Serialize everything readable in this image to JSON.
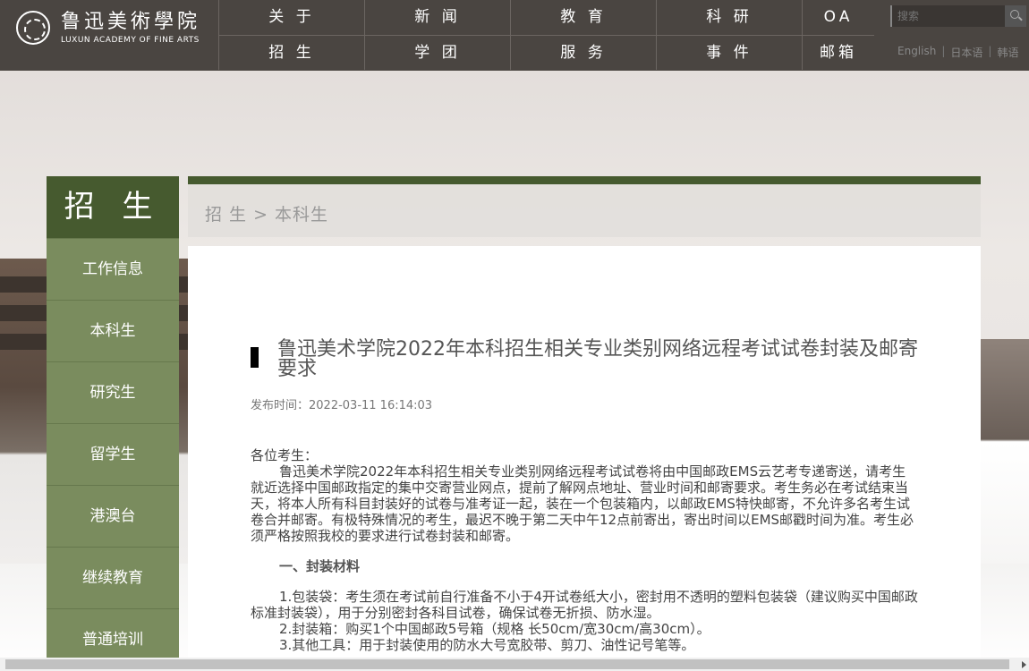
{
  "header": {
    "logo_cn": "鲁迅美術學院",
    "logo_en": "LUXUN ACADEMY OF FINE ARTS",
    "nav_top": [
      "关 于",
      "新 闻",
      "教 育",
      "科 研",
      "OA"
    ],
    "nav_bottom": [
      "招 生",
      "学 团",
      "服 务",
      "事 件",
      "邮箱"
    ],
    "search_placeholder": "搜索",
    "langs": [
      "English",
      "日本语",
      "韩语"
    ]
  },
  "sidebar": {
    "title": "招 生",
    "items": [
      "工作信息",
      "本科生",
      "研究生",
      "留学生",
      "港澳台",
      "继续教育",
      "普通培训"
    ]
  },
  "breadcrumb": "招 生 > 本科生",
  "article": {
    "title": "鲁迅美术学院2022年本科招生相关专业类别网络远程考试试卷封装及邮寄要求",
    "published": "发布时间：2022-03-11 16:14:03",
    "greeting": "各位考生：",
    "para1": "鲁迅美术学院2022年本科招生相关专业类别网络远程考试试卷将由中国邮政EMS云艺考专递寄送，请考生就近选择中国邮政指定的集中交寄营业网点，提前了解网点地址、营业时间和邮寄要求。考生务必在考试结束当天，将本人所有科目封装好的试卷与准考证一起，装在一个包装箱内，以邮政EMS特快邮寄，不允许多名考生试卷合并邮寄。有极特殊情况的考生，最迟不晚于第二天中午12点前寄出，寄出时间以EMS邮戳时间为准。考生必须严格按照我校的要求进行试卷封装和邮寄。",
    "section1": "一、封装材料",
    "item1": "1.包装袋：考生须在考试前自行准备不小于4开试卷纸大小，密封用不透明的塑料包装袋（建议购买中国邮政标准封装袋），用于分别密封各科目试卷，确保试卷无折损、防水湿。",
    "item2": "2.封装箱：购买1个中国邮政5号箱（规格 长50cm/宽30cm/高30cm）。",
    "item3": "3.其他工具：用于封装使用的防水大号宽胶带、剪刀、油性记号笔等。"
  }
}
